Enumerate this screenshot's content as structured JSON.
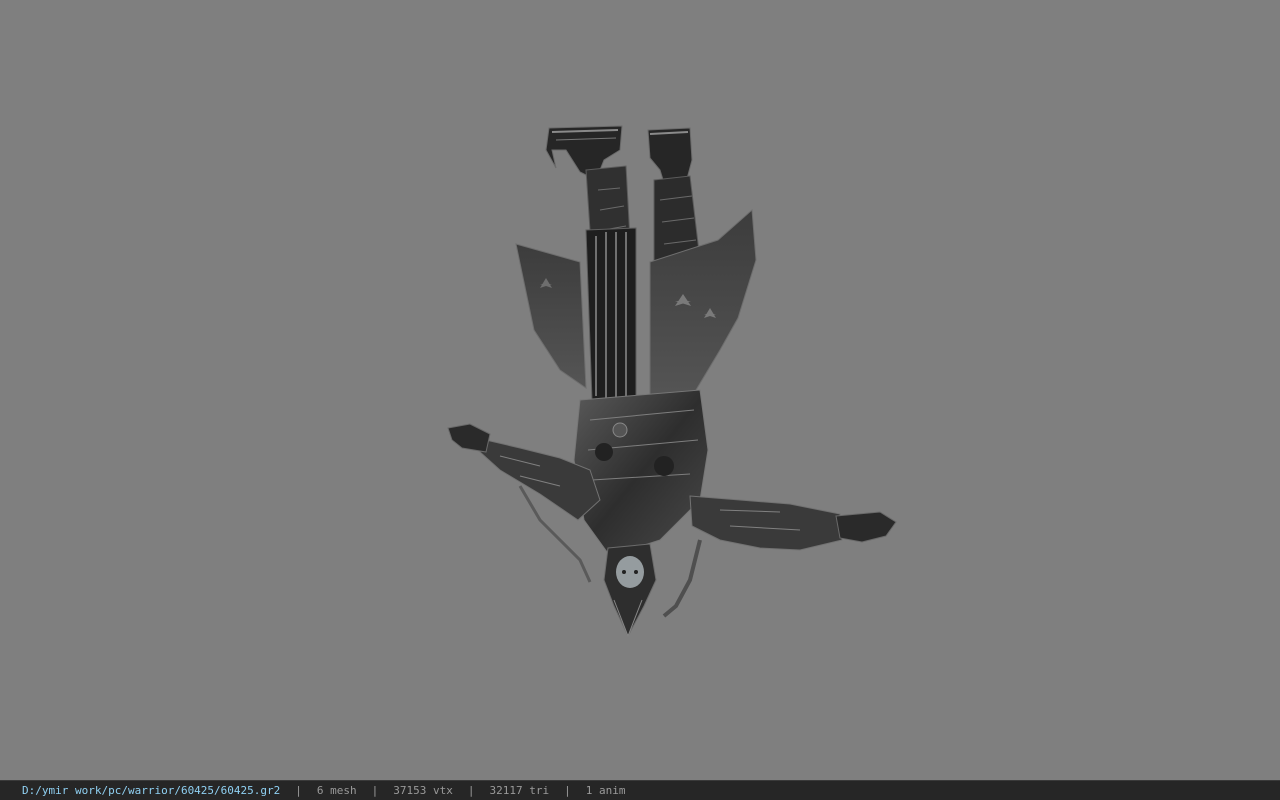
{
  "viewer": {
    "background_color": "#7f7f7f",
    "model_icon": "upside-down-armored-warrior-model"
  },
  "status": {
    "file_path": "D:/ymir work/pc/warrior/60425/60425.gr2",
    "mesh": "6 mesh",
    "vertices": "37153 vtx",
    "triangles": "32117 tri",
    "animations": "1 anim",
    "separator": "|",
    "path_color": "#8fd0f2",
    "text_color": "#9a9a9a"
  }
}
